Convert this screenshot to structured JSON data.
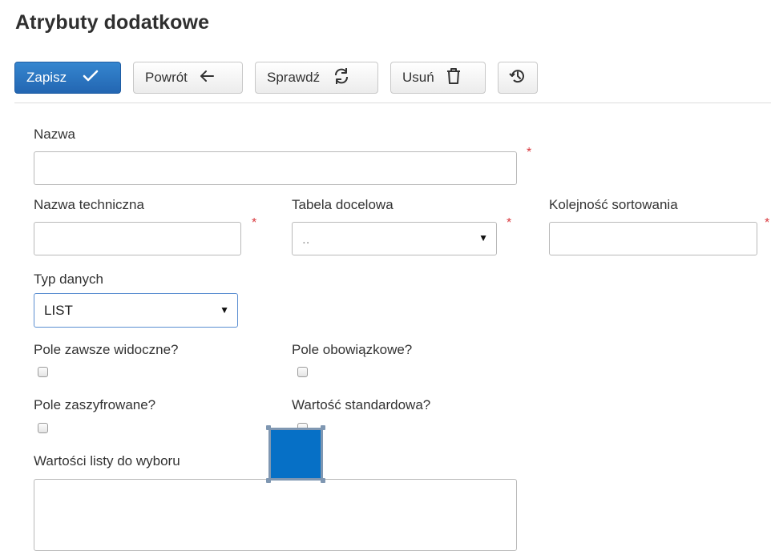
{
  "page": {
    "title": "Atrybuty dodatkowe"
  },
  "toolbar": {
    "save_label": "Zapisz",
    "back_label": "Powrót",
    "check_label": "Sprawdź",
    "delete_label": "Usuń",
    "history_icon": "history-icon"
  },
  "form": {
    "required_marker": "*",
    "name": {
      "label": "Nazwa",
      "value": ""
    },
    "technical_name": {
      "label": "Nazwa techniczna",
      "value": ""
    },
    "target_table": {
      "label": "Tabela docelowa",
      "value": ".."
    },
    "sort_order": {
      "label": "Kolejność sortowania",
      "value": ""
    },
    "data_type": {
      "label": "Typ danych",
      "value": "LIST"
    },
    "always_visible": {
      "label": "Pole zawsze widoczne?",
      "checked": false
    },
    "mandatory": {
      "label": "Pole obowiązkowe?",
      "checked": false
    },
    "encrypted": {
      "label": "Pole zaszyfrowane?",
      "checked": false
    },
    "default_value": {
      "label": "Wartość standardowa?",
      "checked": false
    },
    "list_values": {
      "label": "Wartości listy do wyboru",
      "value": ""
    }
  },
  "colors": {
    "primary": "#2a72bd",
    "required": "#d9393e",
    "overlay": "#0670c6"
  }
}
